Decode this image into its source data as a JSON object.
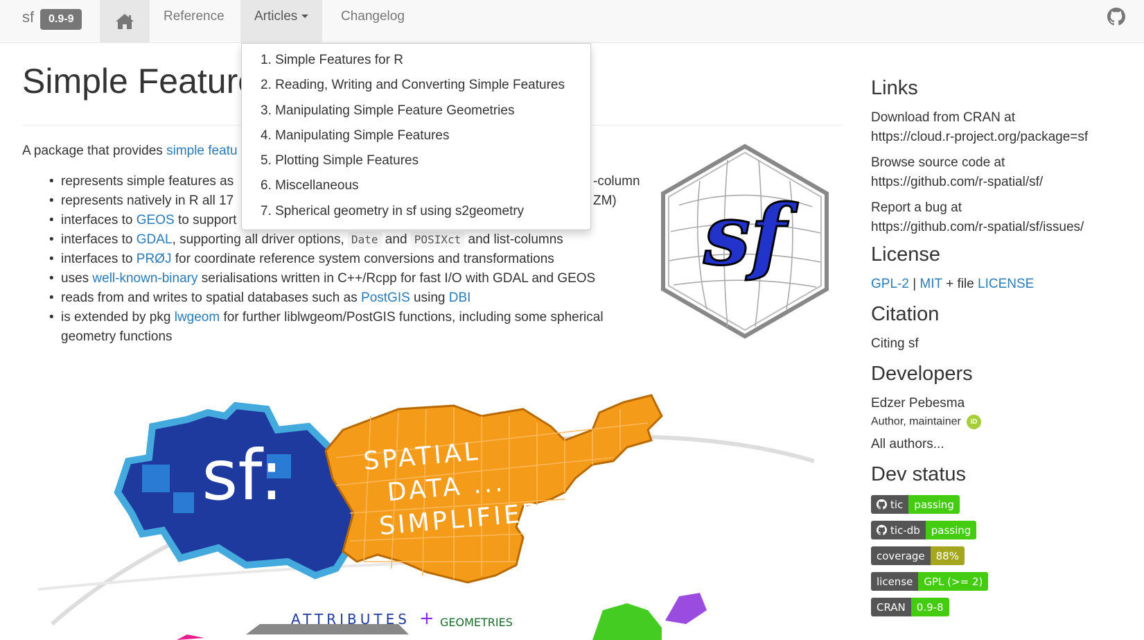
{
  "navbar": {
    "brand": "sf",
    "version": "0.9-9",
    "reference": "Reference",
    "articles": "Articles",
    "changelog": "Changelog",
    "icons": {
      "home": "home-icon",
      "github": "github-icon",
      "caret": "caret-down-icon"
    }
  },
  "articles_menu": [
    "1. Simple Features for R",
    "2. Reading, Writing and Converting Simple Features",
    "3. Manipulating Simple Feature Geometries",
    "4. Manipulating Simple Features",
    "5. Plotting Simple Features",
    "6. Miscellaneous",
    "7. Spherical geometry in sf using s2geometry"
  ],
  "main": {
    "title": "Simple Feature",
    "intro_prefix": "A package that provides ",
    "intro_link": "simple featu",
    "features": {
      "f1_text": "represents simple features as",
      "f1_tail": "-column",
      "f2_text": "represents natively in R all 17",
      "f2_tail": "ZM)",
      "f3_a": "interfaces to ",
      "f3_link": "GEOS",
      "f3_b": " to support",
      "f4_a": "interfaces to ",
      "f4_link": "GDAL",
      "f4_b": ", supporting all driver options, ",
      "f4_code1": "Date",
      "f4_c": " and ",
      "f4_code2": "POSIXct",
      "f4_d": " and list-columns",
      "f5_a": "interfaces to ",
      "f5_link": "PRØJ",
      "f5_b": " for coordinate reference system conversions and transformations",
      "f6_a": "uses ",
      "f6_link": "well-known-binary",
      "f6_b": " serialisations written in C++/Rcpp for fast I/O with GDAL and GEOS",
      "f7_a": "reads from and writes to spatial databases such as ",
      "f7_link1": "PostGIS",
      "f7_b": " using ",
      "f7_link2": "DBI",
      "f8_a": "is extended by pkg ",
      "f8_link": "lwgeom",
      "f8_b": " for further liblwgeom/PostGIS functions, including some spherical geometry functions"
    },
    "logo_text": "sf",
    "artwork": {
      "big": "sf:",
      "line1": "SPATIAL",
      "line2": "DATA ...",
      "line3": "SIMPLIFIED.",
      "attributes": "ATTRIBUTES",
      "plus": "+",
      "geometries": "GEOMETRIES"
    }
  },
  "sidebar": {
    "links_heading": "Links",
    "cran_label": "Download from CRAN at",
    "cran_url": "https://cloud.r-project.org/package=sf",
    "source_label": "Browse source code at",
    "source_url": "https://github.com/r-spatial/sf/",
    "bug_label": "Report a bug at",
    "bug_url": "https://github.com/r-spatial/sf/issues/",
    "license_heading": "License",
    "license_gpl": "GPL-2",
    "license_sep": " | ",
    "license_mit": "MIT",
    "license_file": " + file ",
    "license_link": "LICENSE",
    "citation_heading": "Citation",
    "citation_link": "Citing sf",
    "developers_heading": "Developers",
    "dev_name": "Edzer Pebesma",
    "dev_role": "Author, maintainer",
    "orcid": "iD",
    "all_authors": "All authors...",
    "devstatus_heading": "Dev status",
    "badges": [
      {
        "label": "tic",
        "value": "passing",
        "color": "#4c1"
      },
      {
        "label": "tic-db",
        "value": "passing",
        "color": "#4c1"
      },
      {
        "label": "coverage",
        "value": "88%",
        "color": "#a4a61d"
      },
      {
        "label": "license",
        "value": "GPL (>= 2)",
        "color": "#4c1"
      },
      {
        "label": "CRAN",
        "value": "0.9-8",
        "color": "#4c1"
      }
    ]
  }
}
